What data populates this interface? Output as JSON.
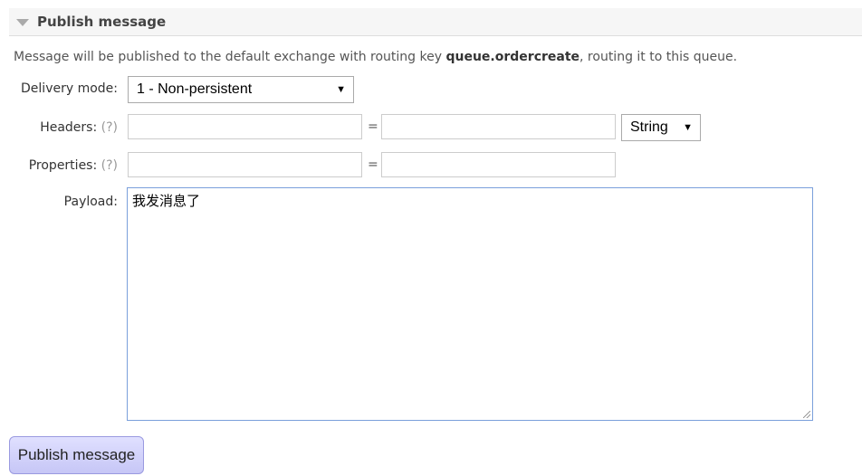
{
  "section": {
    "title": "Publish message",
    "icon": "collapse-triangle-icon"
  },
  "description": {
    "prefix": "Message will be published to the default exchange with routing key ",
    "routing_key": "queue.ordercreate",
    "suffix": ", routing it to this queue."
  },
  "delivery_mode": {
    "label": "Delivery mode:",
    "value": "1 - Non-persistent"
  },
  "headers": {
    "label": "Headers:",
    "help": "(?)",
    "key": "",
    "value": "",
    "equals": "=",
    "type": "String"
  },
  "properties": {
    "label": "Properties:",
    "help": "(?)",
    "key": "",
    "value": "",
    "equals": "="
  },
  "payload": {
    "label": "Payload:",
    "value": "我发消息了"
  },
  "publish_button": "Publish message"
}
